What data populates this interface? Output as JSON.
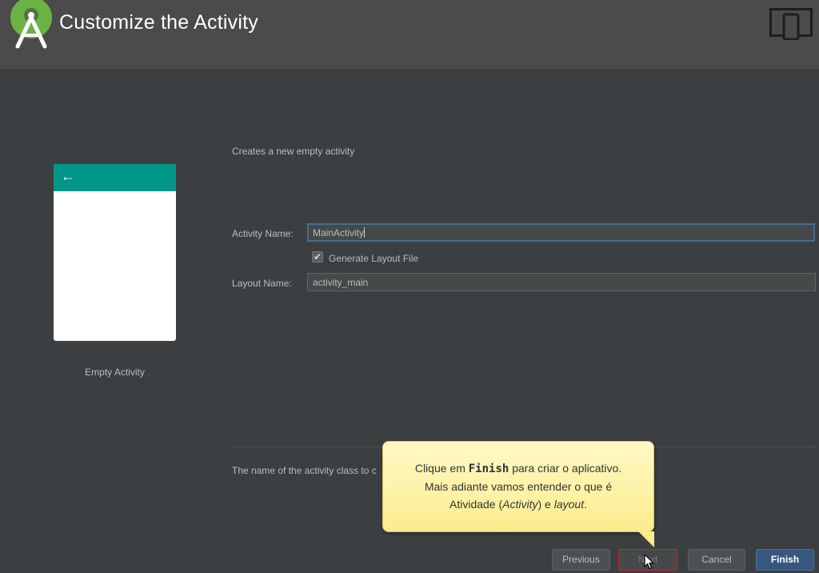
{
  "window": {
    "title": "Customize the Activity",
    "logo_icon": "android-studio-icon",
    "device_icon": "tablet-phone-icon"
  },
  "template": {
    "name": "Empty Activity",
    "bar_color": "#009688",
    "back_arrow": "←"
  },
  "form": {
    "description": "Creates a new empty activity",
    "activity_name_label": "Activity Name:",
    "activity_name_value": "MainActivity",
    "generate_layout_label": "Generate Layout File",
    "generate_layout_checked": true,
    "checkbox_mark": "✔",
    "layout_name_label": "Layout Name:",
    "layout_name_value": "activity_main"
  },
  "help_text": "The name of the activity class to c",
  "tooltip": {
    "line1_pre": "Clique em ",
    "line1_bold": "Finish",
    "line1_post": " para criar o aplicativo.",
    "line2": "Mais adiante vamos entender o que é",
    "line3_pre": "Atividade (",
    "line3_em": "Activity",
    "line3_mid": ") e ",
    "line3_em2": "layout",
    "line3_post": "."
  },
  "buttons": {
    "previous": "Previous",
    "next": "Next",
    "cancel": "Cancel",
    "finish": "Finish"
  },
  "colors": {
    "background": "#3c3f41",
    "header": "#4b4b4b",
    "accent": "#365880",
    "android_green": "#a4c639"
  }
}
